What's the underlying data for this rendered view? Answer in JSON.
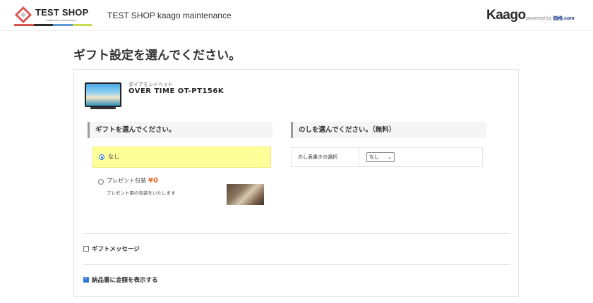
{
  "header": {
    "logo_text": "TEST SHOP",
    "logo_sub": "kaago dev maintenance",
    "site_title": "TEST SHOP kaago maintenance",
    "kaago_logo": "Kaago",
    "powered_by": "powered by",
    "powered_brand": "価格.com",
    "logo_bar_colors": [
      "#d9534f",
      "#2a2a2a",
      "#5b9bd5",
      "#c8d94b"
    ]
  },
  "page": {
    "title": "ギフト設定を選んでください。"
  },
  "product": {
    "maker": "ダイアモンドヘッド",
    "name": "OVER TIME OT-PT156K",
    "image_icon": "monitor-beach-image"
  },
  "gift": {
    "heading": "ギフトを選んでください。",
    "options": [
      {
        "label": "なし",
        "selected": true
      },
      {
        "label": "プレゼント包装",
        "price": "¥0",
        "description": "プレゼント用の包装をいたします",
        "selected": false
      }
    ]
  },
  "noshi": {
    "heading": "のしを選んでください。（無料）",
    "row_label": "のし表書きの選択",
    "selected_value": "なし"
  },
  "checkboxes": {
    "gift_message": {
      "label": "ギフトメッセージ",
      "checked": false
    },
    "show_price": {
      "label": "納品書に金額を表示する",
      "checked": true
    }
  },
  "colors": {
    "accent": "#2878d6",
    "highlight": "#ffff99",
    "price": "#e8661f"
  }
}
